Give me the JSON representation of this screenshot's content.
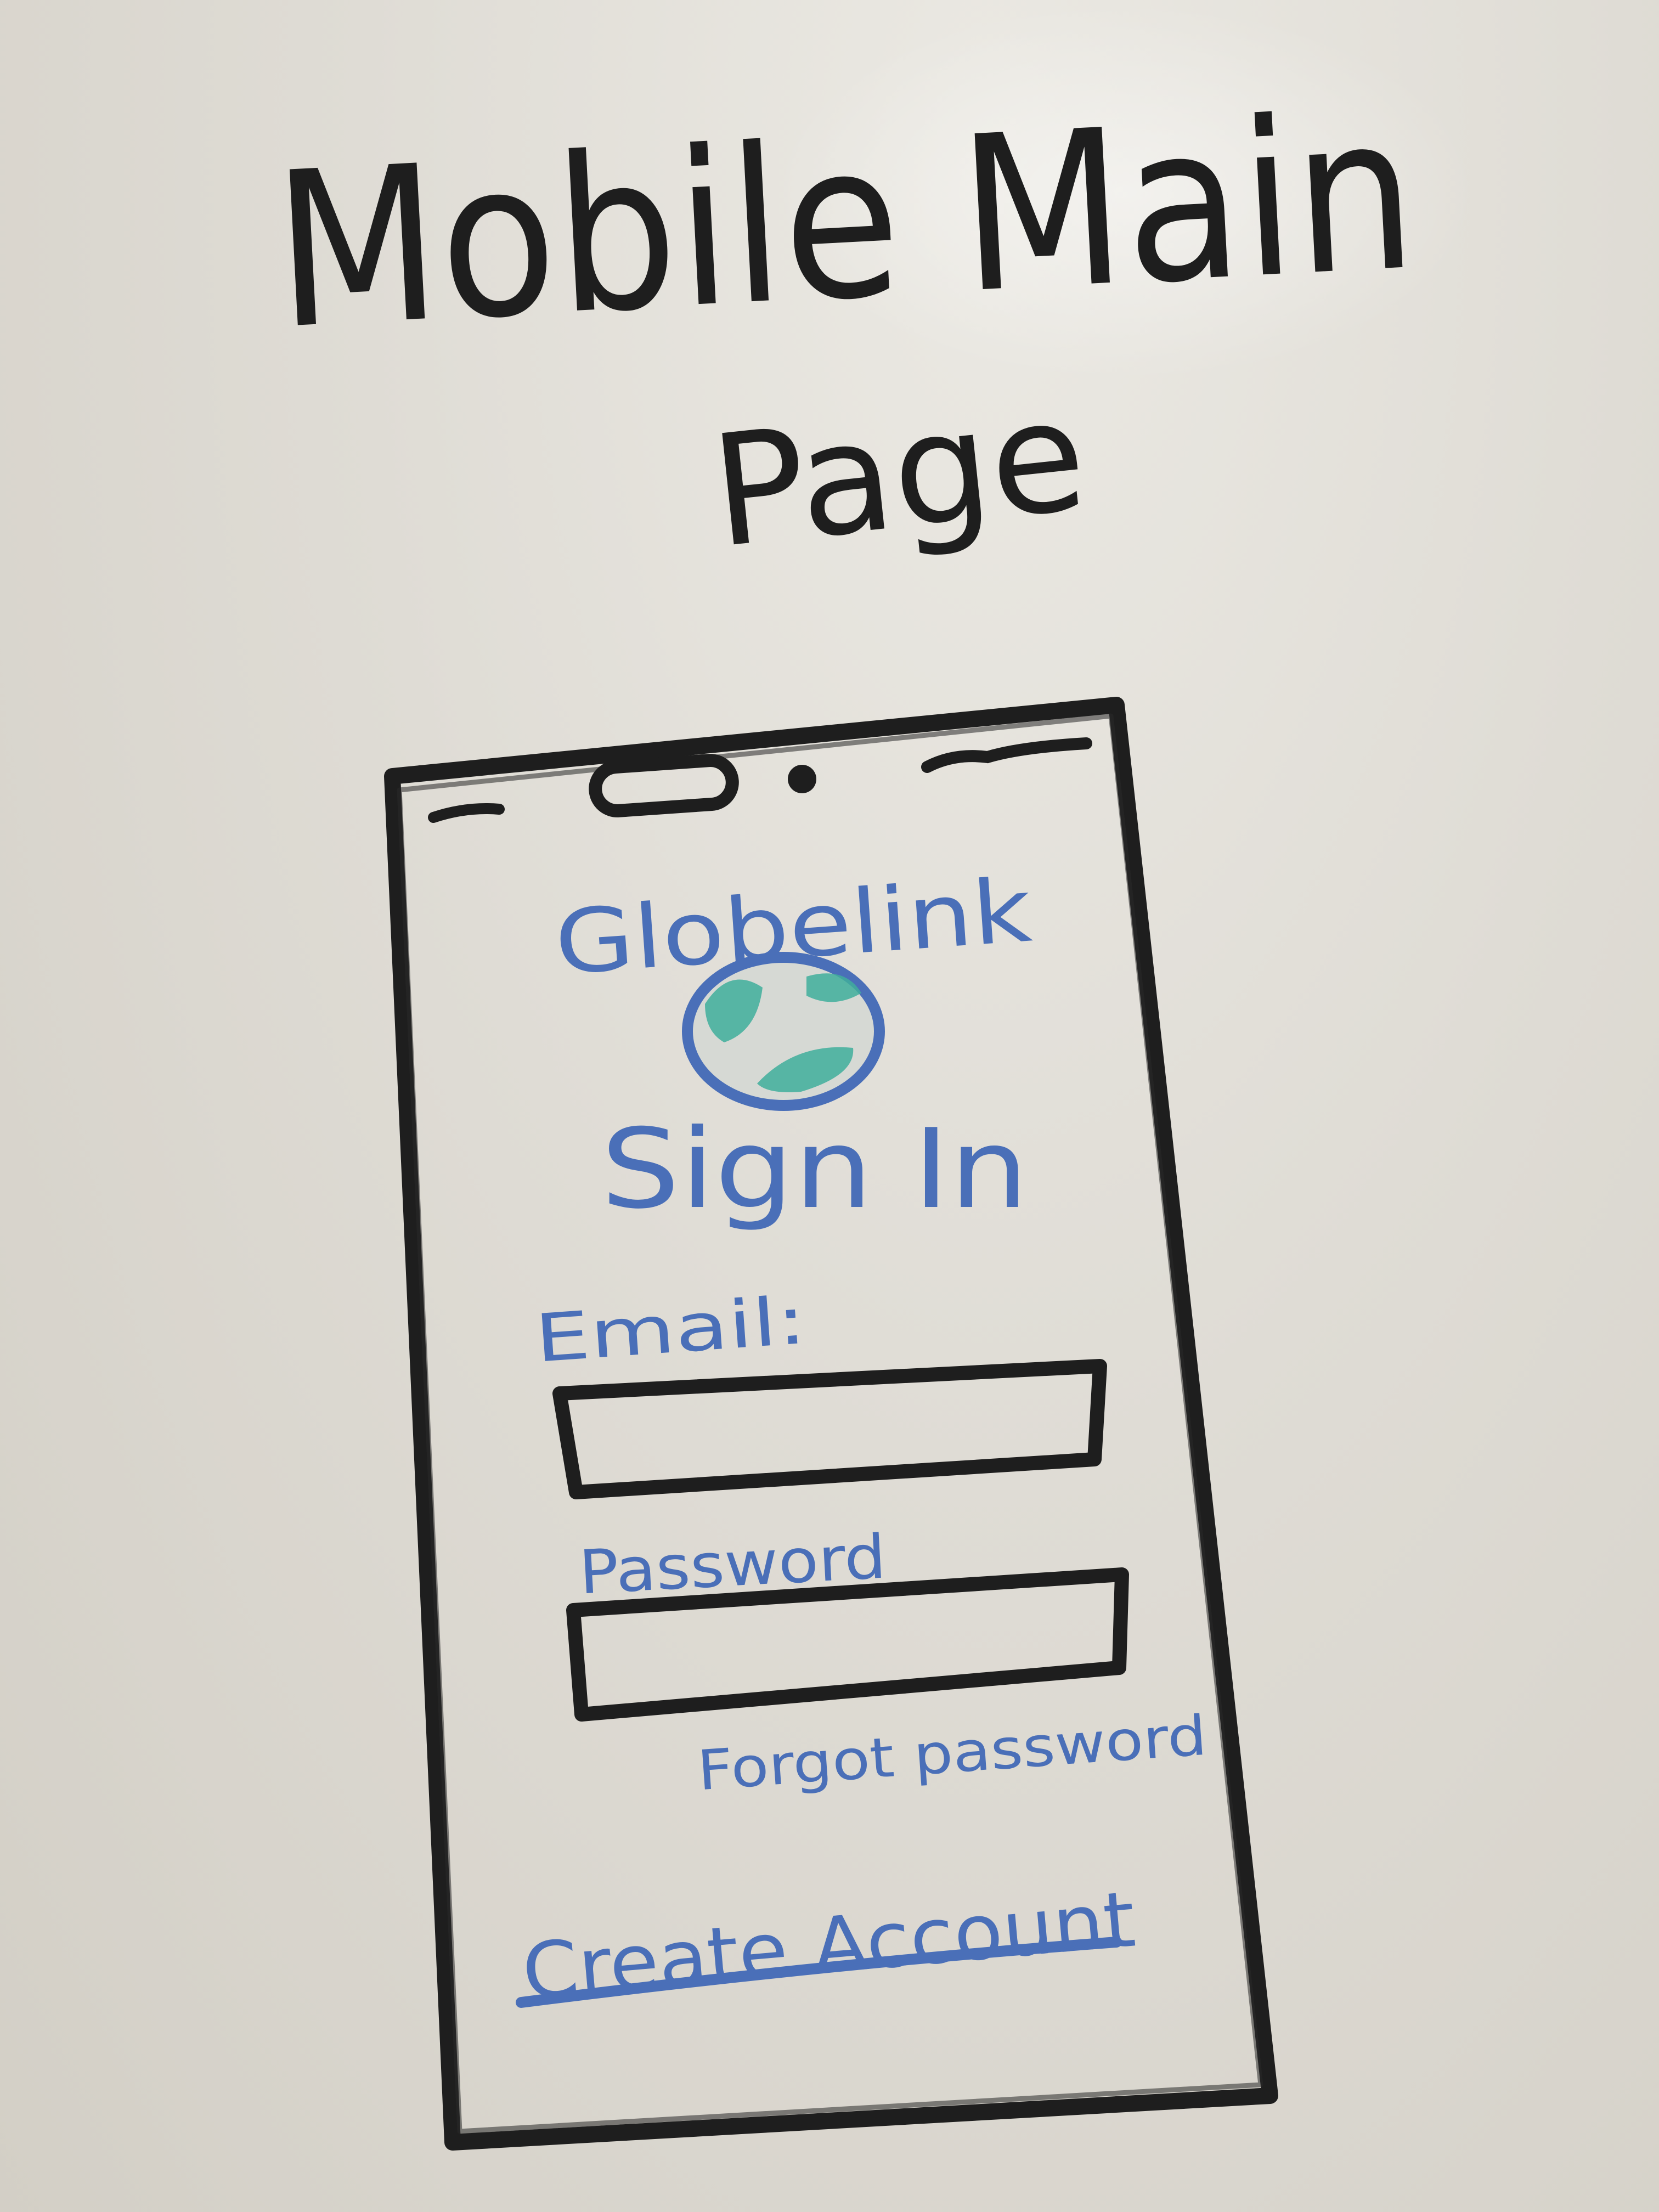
{
  "heading": {
    "line1": "Mobile Main",
    "line2": "Page"
  },
  "app": {
    "name": "Globelink",
    "logo_icon": "globe-icon",
    "title": "Sign In"
  },
  "form": {
    "email_label": "Email:",
    "password_label": "Password",
    "forgot_password_label": "Forgot password",
    "create_account_label": "Create Account"
  },
  "colors": {
    "marker_black": "#1e1e1e",
    "marker_blue": "#4a6fb8",
    "marker_green": "#3fae9b",
    "board": "#dcd8d0"
  }
}
